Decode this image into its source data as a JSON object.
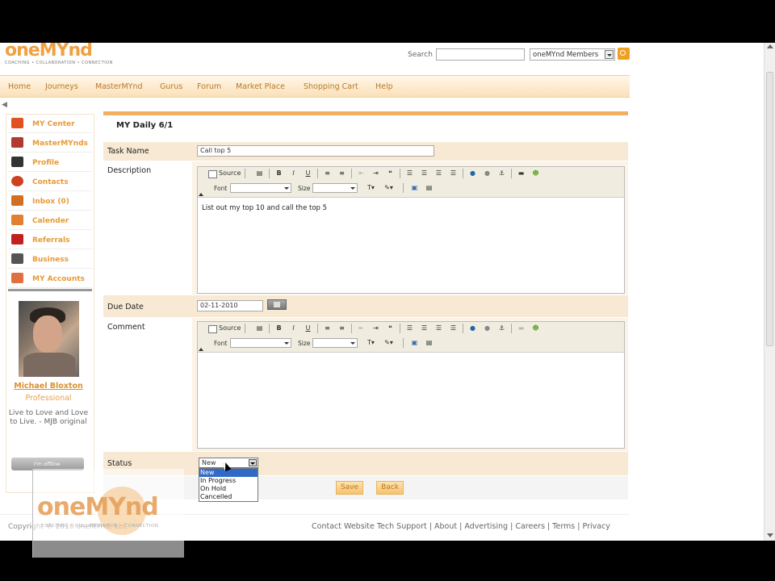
{
  "brand": {
    "logo_text": "oneMYnd",
    "logo_tagline": "COACHING • COLLABORATION • CONNECTION"
  },
  "search": {
    "label": "Search",
    "value": "",
    "scope_selected": "oneMYnd Members"
  },
  "nav": [
    "Home",
    "Journeys",
    "MasterMYnd",
    "Gurus",
    "Forum",
    "Market Place",
    "Shopping Cart",
    "Help"
  ],
  "sidebar": {
    "items": [
      {
        "label": "MY Center",
        "icon": "house-icon",
        "color": "#e05020"
      },
      {
        "label": "MasterMYnds",
        "icon": "masterminds-icon",
        "color": "#b03a2e"
      },
      {
        "label": "Profile",
        "icon": "person-icon",
        "color": "#333333"
      },
      {
        "label": "Contacts",
        "icon": "contacts-icon",
        "color": "#d04020"
      },
      {
        "label": "Inbox (0)",
        "icon": "inbox-icon",
        "color": "#d07020"
      },
      {
        "label": "Calender",
        "icon": "calendar-icon",
        "color": "#e08030"
      },
      {
        "label": "Referrals",
        "icon": "referrals-icon",
        "color": "#c02020"
      },
      {
        "label": "Business",
        "icon": "briefcase-icon",
        "color": "#555555"
      },
      {
        "label": "MY Accounts",
        "icon": "accounts-icon",
        "color": "#e07040"
      }
    ]
  },
  "profile": {
    "name": "Michael Bloxton",
    "title": "Professional",
    "quote": "Live to Love and Love to Live. - MJB original",
    "status_button": "I'm offline"
  },
  "page": {
    "title": "MY Daily 6/1"
  },
  "form": {
    "task_name_label": "Task Name",
    "task_name_value": "Call top 5",
    "description_label": "Description",
    "description_value": "List out my top 10 and call the top 5",
    "due_date_label": "Due Date",
    "due_date_value": "02-11-2010",
    "comment_label": "Comment",
    "comment_value": "",
    "status_label": "Status",
    "status_selected": "New",
    "status_options": [
      "New",
      "In Progress",
      "On Hold",
      "Cancelled"
    ],
    "save_label": "Save",
    "back_label": "Back"
  },
  "editor_toolbar": {
    "source_label": "Source",
    "font_label": "Font",
    "size_label": "Size",
    "bold": "B",
    "italic": "I",
    "underline": "U",
    "quote": "❝"
  },
  "footer": {
    "copyright": "Copyright © 2010 oneMYnd, LLC",
    "links": [
      "Contact Website Tech Support",
      "About",
      "Advertising",
      "Careers",
      "Terms",
      "Privacy"
    ]
  },
  "colors": {
    "accent": "#f0b060",
    "link": "#e69a35",
    "row_shade": "#f7e9d4",
    "select_highlight": "#3169c6"
  }
}
